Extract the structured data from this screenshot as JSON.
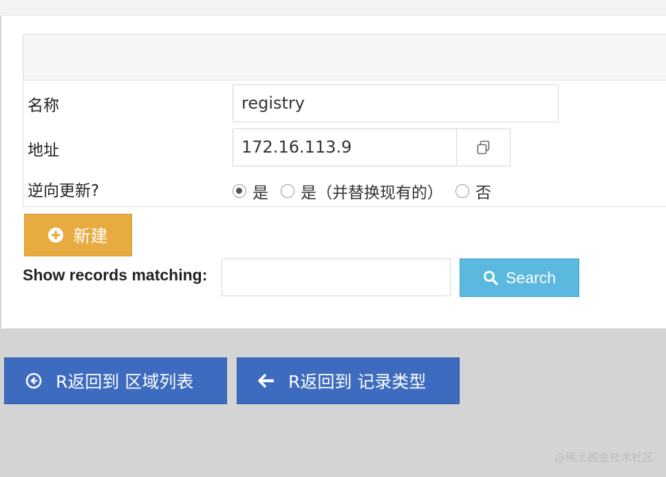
{
  "form": {
    "rows": [
      {
        "label": "名称",
        "value": "registry"
      },
      {
        "label": "地址",
        "value": "172.16.113.9"
      },
      {
        "label": "逆向更新?"
      }
    ],
    "reverse_options": [
      {
        "label": "是",
        "checked": true
      },
      {
        "label": "是（并替换现有的）",
        "checked": false
      },
      {
        "label": "否",
        "checked": false
      }
    ]
  },
  "actions": {
    "new_label": "新建"
  },
  "search": {
    "label": "Show records matching:",
    "value": "",
    "button_label": "Search"
  },
  "nav": {
    "back_to_zones": "R返回到 区域列表",
    "back_to_record_types": "R返回到 记录类型"
  },
  "icons": {
    "new": "plus-circle-icon",
    "copy": "copy-icon",
    "search": "search-icon",
    "back_zones": "circle-arrow-left-icon",
    "back_types": "arrow-left-icon"
  },
  "colors": {
    "new_button": "#e8ab3f",
    "search_button": "#5bb8de",
    "nav_button": "#3d6bbf"
  },
  "watermark": "@稀土掘金技术社区"
}
